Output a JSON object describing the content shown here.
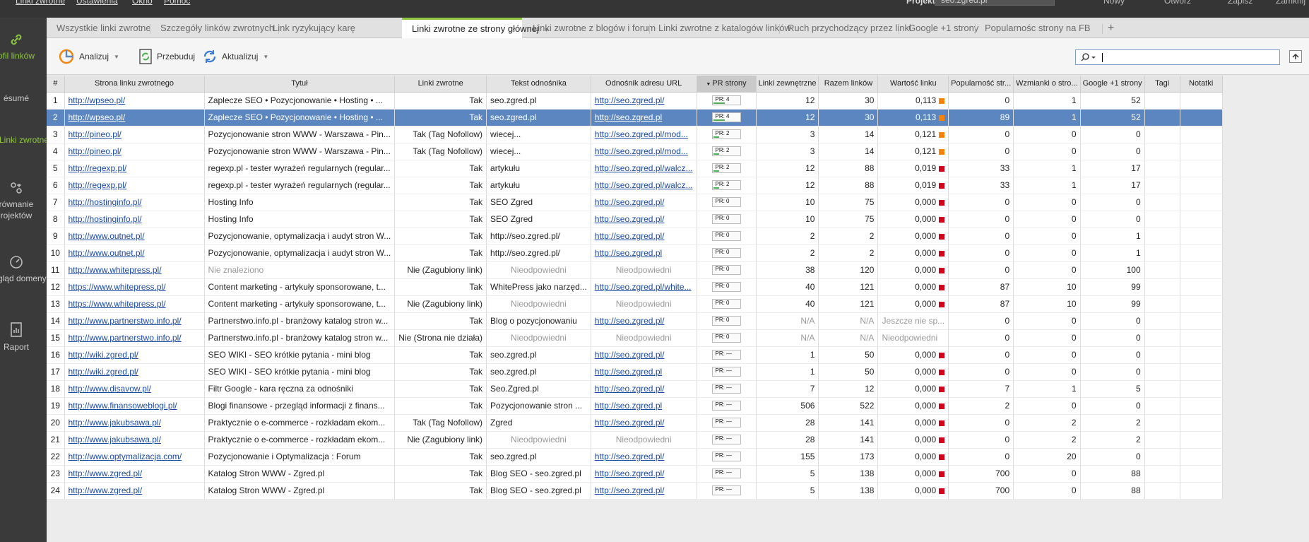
{
  "menubar": {
    "items": [
      "Linki zwrotne",
      "Ustawienia",
      "Okno",
      "Pomoc"
    ],
    "project_label": "Projekt",
    "project_value": "seo.zgred.pl",
    "right_buttons": [
      "Nowy",
      "Otwórz",
      "Zapisz",
      "Zamknij"
    ]
  },
  "sidebar": {
    "items": [
      {
        "label": "ofil linków",
        "icon": "link-icon"
      },
      {
        "label": "ésumé",
        "icon": ""
      },
      {
        "label": "Linki zwrotne",
        "icon": ""
      },
      {
        "label": "równanie rojektów",
        "icon": "compare-icon"
      },
      {
        "label": "rzegląd domeny",
        "icon": "gauge-icon"
      },
      {
        "label": "Raport",
        "icon": "report-icon"
      }
    ]
  },
  "tabs": [
    "Wszystkie linki zwrotne",
    "Szczegóły linków zwrotnych",
    "Link ryzykujący karę",
    "Linki zwrotne ze strony głównej",
    "Linki zwrotne z blogów i forum",
    "Linki zwrotne z katalogów linków",
    "Ruch przychodzący przez linki",
    "Google +1 strony",
    "Popularnośc strony na FB"
  ],
  "toolbar": {
    "analyze": "Analizuj",
    "rebuild": "Przebuduj",
    "update": "Aktualizuj"
  },
  "search": {
    "placeholder": "",
    "value": ""
  },
  "colors": {
    "accent": "#8dc63f",
    "selected_row": "#5b86c0",
    "low": "#d0021b",
    "mid": "#f5820a"
  },
  "columns": [
    "#",
    "Strona linku zwrotnego",
    "Tytuł",
    "Linki zwrotne",
    "Tekst odnośnika",
    "Odnośnik adresu URL",
    "PR strony",
    "Linki zewnętrzne",
    "Razem linków",
    "Wartość linku",
    "Popularność str...",
    "Wzmianki o stro...",
    "Google +1 strony",
    "Tagi",
    "Notatki"
  ],
  "rows": [
    {
      "n": "1",
      "url": "http://wpseo.pl/",
      "title": "Zaplecze SEO • Pozycjonowanie • Hosting • ...",
      "lz": "Tak",
      "anchor": "seo.zgred.pl",
      "target": "http://seo.zgred.pl/",
      "pr": "PR: 4",
      "pr_fill": 0.4,
      "ext": "12",
      "tot": "30",
      "val": "0,113",
      "val_color": "#f5820a",
      "pop": "0",
      "wzm": "1",
      "g": "52"
    },
    {
      "n": "2",
      "url": "http://wpseo.pl/",
      "title": "Zaplecze SEO • Pozycjonowanie • Hosting • ...",
      "lz": "Tak",
      "anchor": "seo.zgred.pl",
      "target": "http://seo.zgred.pl",
      "pr": "PR: 4",
      "pr_fill": 0.4,
      "ext": "12",
      "tot": "30",
      "val": "0,113",
      "val_color": "#f5820a",
      "pop": "89",
      "wzm": "1",
      "g": "52",
      "selected": true
    },
    {
      "n": "3",
      "url": "http://pineo.pl/",
      "title": "Pozycjonowanie stron WWW - Warszawa - Pin...",
      "lz": "Tak (Tag Nofollow)",
      "anchor": "wiecej...",
      "target": "http://seo.zgred.pl/mod...",
      "pr": "PR: 2",
      "pr_fill": 0.2,
      "ext": "3",
      "tot": "14",
      "val": "0,121",
      "val_color": "#f5820a",
      "pop": "0",
      "wzm": "0",
      "g": "0"
    },
    {
      "n": "4",
      "url": "http://pineo.pl/",
      "title": "Pozycjonowanie stron WWW - Warszawa - Pin...",
      "lz": "Tak (Tag Nofollow)",
      "anchor": "wiecej...",
      "target": "http://seo.zgred.pl/mod...",
      "pr": "PR: 2",
      "pr_fill": 0.2,
      "ext": "3",
      "tot": "14",
      "val": "0,121",
      "val_color": "#f5820a",
      "pop": "0",
      "wzm": "0",
      "g": "0"
    },
    {
      "n": "5",
      "url": "http://regexp.pl/",
      "title": "regexp.pl - tester wyrażeń regularnych (regular...",
      "lz": "Tak",
      "anchor": "artykułu",
      "target": "http://seo.zgred.pl/walcz...",
      "pr": "PR: 2",
      "pr_fill": 0.2,
      "ext": "12",
      "tot": "88",
      "val": "0,019",
      "val_color": "#d0021b",
      "pop": "33",
      "wzm": "1",
      "g": "17"
    },
    {
      "n": "6",
      "url": "http://regexp.pl/",
      "title": "regexp.pl - tester wyrażeń regularnych (regular...",
      "lz": "Tak",
      "anchor": "artykułu",
      "target": "http://seo.zgred.pl/walcz...",
      "pr": "PR: 2",
      "pr_fill": 0.2,
      "ext": "12",
      "tot": "88",
      "val": "0,019",
      "val_color": "#d0021b",
      "pop": "33",
      "wzm": "1",
      "g": "17"
    },
    {
      "n": "7",
      "url": "http://hostinginfo.pl/",
      "title": "Hosting Info",
      "lz": "Tak",
      "anchor": "SEO Zgred",
      "target": "http://seo.zgred.pl/",
      "pr": "PR: 0",
      "pr_fill": 0,
      "ext": "10",
      "tot": "75",
      "val": "0,000",
      "val_color": "#d0021b",
      "pop": "0",
      "wzm": "0",
      "g": "0"
    },
    {
      "n": "8",
      "url": "http://hostinginfo.pl/",
      "title": "Hosting Info",
      "lz": "Tak",
      "anchor": "SEO Zgred",
      "target": "http://seo.zgred.pl/",
      "pr": "PR: 0",
      "pr_fill": 0,
      "ext": "10",
      "tot": "75",
      "val": "0,000",
      "val_color": "#d0021b",
      "pop": "0",
      "wzm": "0",
      "g": "0"
    },
    {
      "n": "9",
      "url": "http://www.outnet.pl/",
      "title": "Pozycjonowanie, optymalizacja i audyt stron W...",
      "lz": "Tak",
      "anchor": "http://seo.zgred.pl/",
      "target": "http://seo.zgred.pl/",
      "pr": "PR: 0",
      "pr_fill": 0,
      "ext": "2",
      "tot": "2",
      "val": "0,000",
      "val_color": "#d0021b",
      "pop": "0",
      "wzm": "0",
      "g": "1"
    },
    {
      "n": "10",
      "url": "http://www.outnet.pl/",
      "title": "Pozycjonowanie, optymalizacja i audyt stron W...",
      "lz": "Tak",
      "anchor": "http://seo.zgred.pl/",
      "target": "http://seo.zgred.pl",
      "pr": "PR: 0",
      "pr_fill": 0,
      "ext": "2",
      "tot": "2",
      "val": "0,000",
      "val_color": "#d0021b",
      "pop": "0",
      "wzm": "0",
      "g": "1"
    },
    {
      "n": "11",
      "url": "http://www.whitepress.pl/",
      "title": "Nie znaleziono",
      "title_gray": true,
      "lz": "Nie (Zagubiony link)",
      "anchor": "Nieodpowiedni",
      "anchor_gray": true,
      "target": "Nieodpowiedni",
      "target_gray": true,
      "pr": "PR: 0",
      "pr_fill": 0,
      "ext": "38",
      "tot": "120",
      "val": "0,000",
      "val_color": "#d0021b",
      "pop": "0",
      "wzm": "0",
      "g": "100"
    },
    {
      "n": "12",
      "url": "https://www.whitepress.pl/",
      "title": "Content marketing - artykuły sponsorowane, t...",
      "lz": "Tak",
      "anchor": "WhitePress jako narzęd...",
      "target": "http://seo.zgred.pl/white...",
      "pr": "PR: 0",
      "pr_fill": 0,
      "ext": "40",
      "tot": "121",
      "val": "0,000",
      "val_color": "#d0021b",
      "pop": "87",
      "wzm": "10",
      "g": "99"
    },
    {
      "n": "13",
      "url": "https://www.whitepress.pl/",
      "title": "Content marketing - artykuły sponsorowane, t...",
      "lz": "Nie (Zagubiony link)",
      "anchor": "Nieodpowiedni",
      "anchor_gray": true,
      "target": "Nieodpowiedni",
      "target_gray": true,
      "pr": "PR: 0",
      "pr_fill": 0,
      "ext": "40",
      "tot": "121",
      "val": "0,000",
      "val_color": "#d0021b",
      "pop": "87",
      "wzm": "10",
      "g": "99"
    },
    {
      "n": "14",
      "url": "http://www.partnerstwo.info.pl/",
      "title": "Partnerstwo.info.pl - branżowy katalog stron w...",
      "lz": "Tak",
      "anchor": "Blog o pozycjonowaniu",
      "target": "http://seo.zgred.pl/",
      "pr": "PR: 0",
      "pr_fill": 0,
      "ext": "N/A",
      "tot": "N/A",
      "val": "Jeszcze nie sp...",
      "val_gray": true,
      "pop": "0",
      "wzm": "0",
      "g": "0"
    },
    {
      "n": "15",
      "url": "http://www.partnerstwo.info.pl/",
      "title": "Partnerstwo.info.pl - branżowy katalog stron w...",
      "lz": "Nie (Strona nie działa)",
      "anchor": "Nieodpowiedni",
      "anchor_gray": true,
      "target": "Nieodpowiedni",
      "target_gray": true,
      "pr": "PR: 0",
      "pr_fill": 0,
      "ext": "N/A",
      "tot": "N/A",
      "val": "Nieodpowiedni",
      "val_gray": true,
      "pop": "0",
      "wzm": "0",
      "g": "0"
    },
    {
      "n": "16",
      "url": "http://wiki.zgred.pl/",
      "title": "SEO WIKI - SEO krótkie pytania - mini blog",
      "lz": "Tak",
      "anchor": "seo.zgred.pl",
      "target": "http://seo.zgred.pl/",
      "pr": "PR: —",
      "pr_fill": 0,
      "ext": "1",
      "tot": "50",
      "val": "0,000",
      "val_color": "#d0021b",
      "pop": "0",
      "wzm": "0",
      "g": "0"
    },
    {
      "n": "17",
      "url": "http://wiki.zgred.pl/",
      "title": "SEO WIKI - SEO krótkie pytania - mini blog",
      "lz": "Tak",
      "anchor": "seo.zgred.pl",
      "target": "http://seo.zgred.pl",
      "pr": "PR: —",
      "pr_fill": 0,
      "ext": "1",
      "tot": "50",
      "val": "0,000",
      "val_color": "#d0021b",
      "pop": "0",
      "wzm": "0",
      "g": "0"
    },
    {
      "n": "18",
      "url": "http://www.disavow.pl/",
      "title": "Filtr Google - kara ręczna za odnośniki",
      "lz": "Tak",
      "anchor": "Seo.Zgred.pl",
      "target": "http://seo.zgred.pl/",
      "pr": "PR: —",
      "pr_fill": 0,
      "ext": "7",
      "tot": "12",
      "val": "0,000",
      "val_color": "#d0021b",
      "pop": "7",
      "wzm": "1",
      "g": "5"
    },
    {
      "n": "19",
      "url": "http://www.finansoweblogi.pl/",
      "title": "Blogi finansowe - przegląd informacji z finans...",
      "lz": "Tak",
      "anchor": "Pozycjonowanie stron ...",
      "target": "http://seo.zgred.pl",
      "pr": "PR: —",
      "pr_fill": 0,
      "ext": "506",
      "tot": "522",
      "val": "0,000",
      "val_color": "#d0021b",
      "pop": "2",
      "wzm": "0",
      "g": "0"
    },
    {
      "n": "20",
      "url": "http://www.jakubsawa.pl/",
      "title": "Praktycznie o e-commerce - rozkładam ekom...",
      "lz": "Tak (Tag Nofollow)",
      "anchor": "Zgred",
      "target": "http://seo.zgred.pl/",
      "pr": "PR: —",
      "pr_fill": 0,
      "ext": "28",
      "tot": "141",
      "val": "0,000",
      "val_color": "#d0021b",
      "pop": "0",
      "wzm": "2",
      "g": "2"
    },
    {
      "n": "21",
      "url": "http://www.jakubsawa.pl/",
      "title": "Praktycznie o e-commerce - rozkładam ekom...",
      "lz": "Nie (Zagubiony link)",
      "anchor": "Nieodpowiedni",
      "anchor_gray": true,
      "target": "Nieodpowiedni",
      "target_gray": true,
      "pr": "PR: —",
      "pr_fill": 0,
      "ext": "28",
      "tot": "141",
      "val": "0,000",
      "val_color": "#d0021b",
      "pop": "0",
      "wzm": "2",
      "g": "2"
    },
    {
      "n": "22",
      "url": "http://www.optymalizacja.com/",
      "title": "Pozycjonowanie i Optymalizacja : Forum",
      "lz": "Tak",
      "anchor": "seo.zgred.pl",
      "target": "http://seo.zgred.pl/",
      "pr": "PR: —",
      "pr_fill": 0,
      "ext": "155",
      "tot": "173",
      "val": "0,000",
      "val_color": "#d0021b",
      "pop": "0",
      "wzm": "20",
      "g": "0"
    },
    {
      "n": "23",
      "url": "http://www.zgred.pl/",
      "title": "Katalog Stron WWW - Zgred.pl",
      "lz": "Tak",
      "anchor": "Blog SEO - seo.zgred.pl",
      "target": "http://seo.zgred.pl/",
      "pr": "PR: —",
      "pr_fill": 0,
      "ext": "5",
      "tot": "138",
      "val": "0,000",
      "val_color": "#d0021b",
      "pop": "700",
      "wzm": "0",
      "g": "88"
    },
    {
      "n": "24",
      "url": "http://www.zgred.pl/",
      "title": "Katalog Stron WWW - Zgred.pl",
      "lz": "Tak",
      "anchor": "Blog SEO - seo.zgred.pl",
      "target": "http://seo.zgred.pl/",
      "pr": "PR: —",
      "pr_fill": 0,
      "ext": "5",
      "tot": "138",
      "val": "0,000",
      "val_color": "#d0021b",
      "pop": "700",
      "wzm": "0",
      "g": "88"
    }
  ]
}
